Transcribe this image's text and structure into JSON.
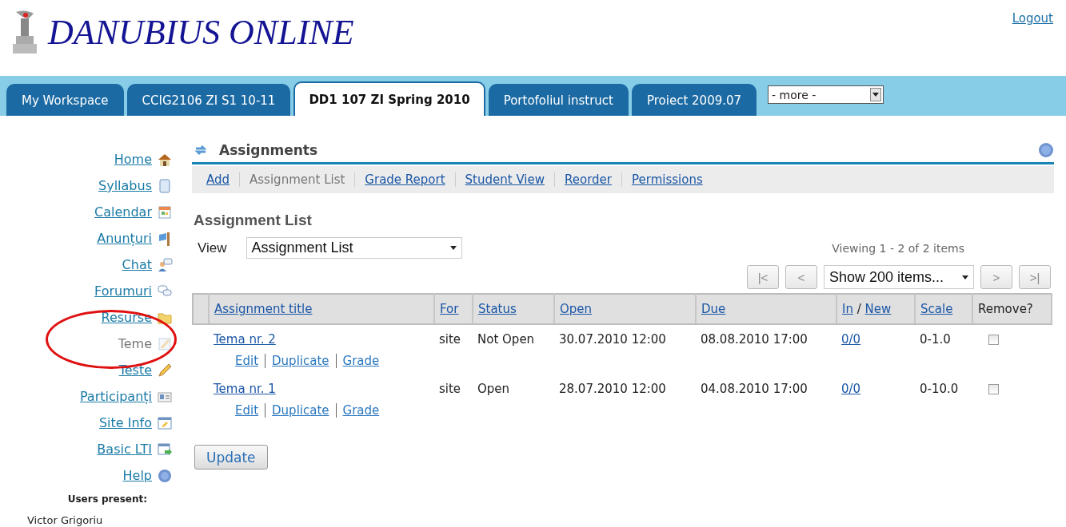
{
  "logo": {
    "text": "DANUBIUS ONLINE"
  },
  "logout": "Logout",
  "tabs": [
    {
      "label": "My Workspace",
      "selected": false
    },
    {
      "label": "CCIG2106 ZI S1 10-11",
      "selected": false
    },
    {
      "label": "DD1 107 ZI Spring 2010",
      "selected": true
    },
    {
      "label": "Portofoliul instruct",
      "selected": false
    },
    {
      "label": "Proiect 2009.07",
      "selected": false
    }
  ],
  "more_select": {
    "value": "- more -"
  },
  "sidebar": {
    "items": [
      {
        "label": "Home",
        "selected": false
      },
      {
        "label": "Syllabus",
        "selected": false
      },
      {
        "label": "Calendar",
        "selected": false
      },
      {
        "label": "Anunțuri",
        "selected": false
      },
      {
        "label": "Chat",
        "selected": false
      },
      {
        "label": "Forumuri",
        "selected": false
      },
      {
        "label": "Resurse",
        "selected": false
      },
      {
        "label": "Teme",
        "selected": true
      },
      {
        "label": "Teste",
        "selected": false
      },
      {
        "label": "Participanți",
        "selected": false
      },
      {
        "label": "Site Info",
        "selected": false
      },
      {
        "label": "Basic LTI",
        "selected": false
      },
      {
        "label": "Help",
        "selected": false
      }
    ],
    "users_present_label": "Users present:",
    "users": [
      "Victor Grigoriu"
    ]
  },
  "tool": {
    "title": "Assignments",
    "toolbar": [
      {
        "label": "Add",
        "selected": false
      },
      {
        "label": "Assignment List",
        "selected": true
      },
      {
        "label": "Grade Report",
        "selected": false
      },
      {
        "label": "Student View",
        "selected": false
      },
      {
        "label": "Reorder",
        "selected": false
      },
      {
        "label": "Permissions",
        "selected": false
      }
    ],
    "heading": "Assignment List",
    "view_label": "View",
    "view_select": {
      "value": "Assignment List"
    },
    "viewing": "Viewing 1 - 2 of 2 items",
    "pager_buttons": [
      "|<",
      "<",
      ">",
      ">|"
    ],
    "page_size_select": {
      "value": "Show 200 items..."
    },
    "table": {
      "columns": [
        {
          "kind": "link",
          "labels": [
            "Assignment title"
          ]
        },
        {
          "kind": "link",
          "labels": [
            "For"
          ]
        },
        {
          "kind": "link",
          "labels": [
            "Status"
          ]
        },
        {
          "kind": "link",
          "labels": [
            "Open"
          ]
        },
        {
          "kind": "link",
          "labels": [
            "Due"
          ]
        },
        {
          "kind": "pair",
          "labels": [
            "In",
            "New"
          ],
          "separator": "/"
        },
        {
          "kind": "link",
          "labels": [
            "Scale"
          ]
        },
        {
          "kind": "text",
          "labels": [
            "Remove?"
          ]
        }
      ],
      "rows": [
        {
          "title": "Tema nr. 2",
          "actions": [
            "Edit",
            "Duplicate",
            "Grade"
          ],
          "for": "site",
          "status": "Not Open",
          "open": "30.07.2010 12:00",
          "due": "08.08.2010 17:00",
          "in_new": "0/0",
          "scale": "0-1.0",
          "remove_checked": false
        },
        {
          "title": "Tema nr. 1",
          "actions": [
            "Edit",
            "Duplicate",
            "Grade"
          ],
          "for": "site",
          "status": "Open",
          "open": "28.07.2010 12:00",
          "due": "04.08.2010 17:00",
          "in_new": "0/0",
          "scale": "0-10.0",
          "remove_checked": false
        }
      ]
    },
    "update_button": "Update"
  }
}
